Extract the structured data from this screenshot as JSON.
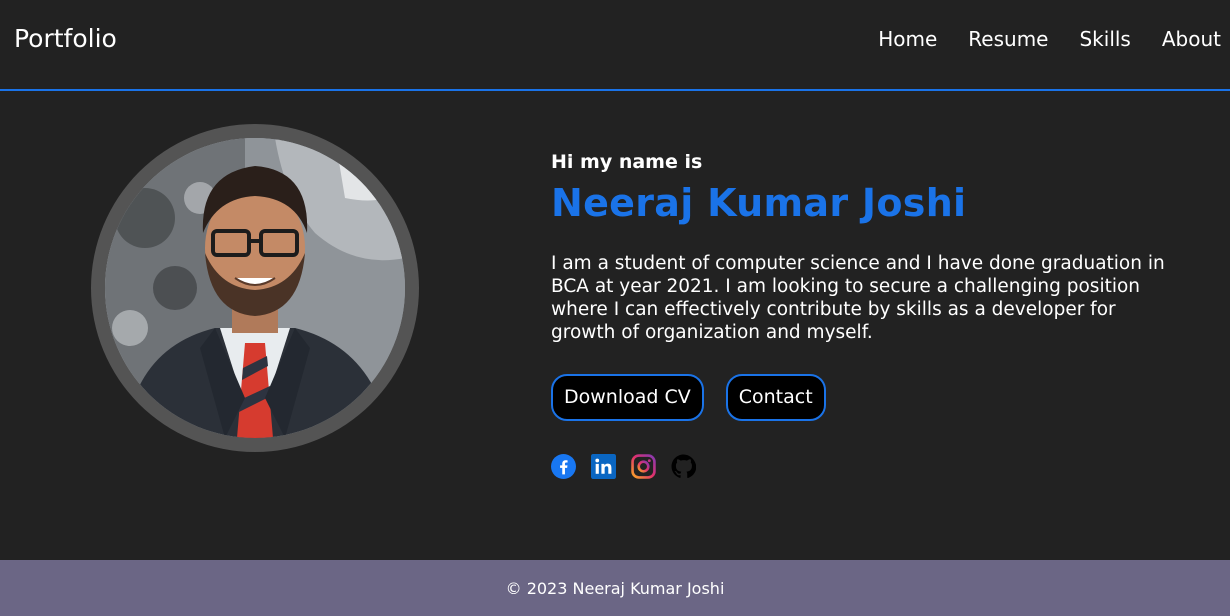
{
  "header": {
    "brand": "Portfolio",
    "nav": [
      "Home",
      "Resume",
      "Skills",
      "About"
    ]
  },
  "intro": {
    "greeting": "Hi my name is",
    "name": "Neeraj Kumar Joshi",
    "bio": "I am a student of computer science and I have done graduation in BCA at year 2021. I am looking to secure a challenging position where I can effectively contribute by skills as a developer for growth of organization and myself.",
    "buttons": {
      "download": "Download CV",
      "contact": "Contact"
    },
    "socials": [
      "facebook-icon",
      "linkedin-icon",
      "instagram-icon",
      "github-icon"
    ]
  },
  "footer": {
    "copyright": "© 2023 Neeraj Kumar Joshi"
  },
  "colors": {
    "background": "#222222",
    "accent": "#1a73e8",
    "footer": "#6b6685"
  }
}
